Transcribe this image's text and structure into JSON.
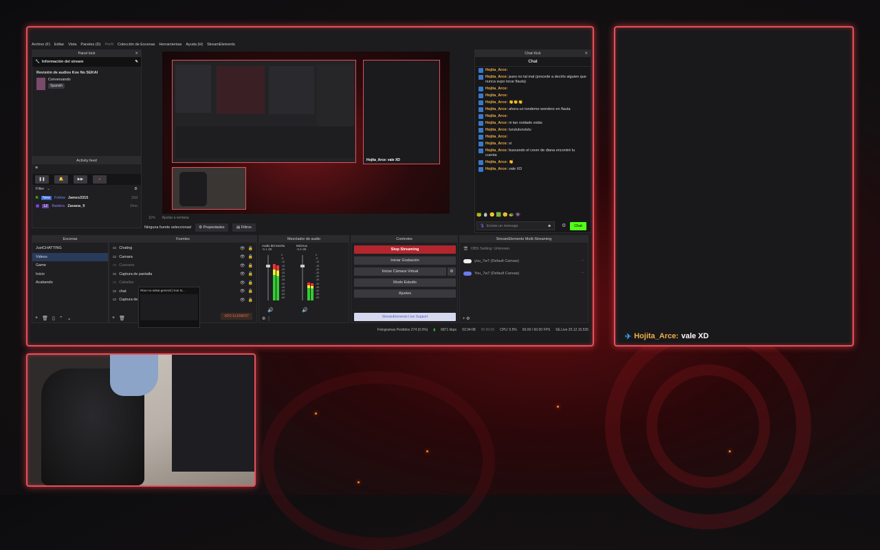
{
  "obs": {
    "menu": [
      "Archivo (F)",
      "Editar",
      "Vista",
      "Paneles (D)",
      "Perfil",
      "Colección de Escenas",
      "Herramientas",
      "Ayuda (H)",
      "StreamElements"
    ],
    "panel_kick": {
      "title": "Panel kick",
      "info_title": "Información del stream",
      "stream_title": "Revisión de audios Koe No SEKAI",
      "category": "Conversando",
      "tag": "Spanish"
    },
    "activity": {
      "title": "Activity feed",
      "filter": "Filter",
      "items": [
        {
          "badge": "New",
          "status": "Follow",
          "user": "James3315",
          "time": "15d"
        },
        {
          "badge": "12",
          "status": "Raiders",
          "user": "Zavana_9",
          "time": "2mo"
        }
      ]
    },
    "preview_overlay_chat": "Hojita_Arce: vale XD",
    "source_toolbar": {
      "none_selected": "Ninguna fuente seleccionad",
      "properties": "Propiedades",
      "filters": "Filtros",
      "zoom": "11%",
      "window": "Ajustar a ventana"
    },
    "chat_kick": {
      "title": "Chat Kick",
      "header": "Chat",
      "send_placeholder": "Enviar un mensaje",
      "send_button": "Chat",
      "messages": [
        {
          "user": "Hojita_Arce:",
          "text": ""
        },
        {
          "user": "Hojita_Arce:",
          "text": "pues no tal mal (procede a decirlo alguien que nunca supo tocar flauta)"
        },
        {
          "user": "Hojita_Arce:",
          "text": ""
        },
        {
          "user": "Hojita_Arce:",
          "text": ""
        },
        {
          "user": "Hojita_Arce:",
          "text": "👏👏👏"
        },
        {
          "user": "Hojita_Arce:",
          "text": "ahora un tondemo wonderz en flauta"
        },
        {
          "user": "Hojita_Arce:",
          "text": ""
        },
        {
          "user": "Hojita_Arce:",
          "text": "ni tan oxidado estás"
        },
        {
          "user": "Hojita_Arce:",
          "text": "turututurututu"
        },
        {
          "user": "Hojita_Arce:",
          "text": ""
        },
        {
          "user": "Hojita_Arce:",
          "text": "si"
        },
        {
          "user": "Hojita_Arce:",
          "text": "buscando el cover de diana encontré tu cuenta"
        },
        {
          "user": "Hojita_Arce:",
          "text": "👏"
        },
        {
          "user": "Hojita_Arce:",
          "text": "vale XD"
        }
      ]
    },
    "escenas": {
      "title": "Escenas",
      "items": [
        "JustCHATTING",
        "Videos",
        "Game",
        "Inicio",
        "Acabando"
      ],
      "selected": 1
    },
    "fuentes": {
      "title": "Fuentes",
      "items": [
        "Chating",
        "Camara",
        "Cuevana",
        "Captura de pantalla",
        "Caballas",
        "chat",
        "Captura de"
      ],
      "add": "ADD ELEMENT",
      "tooltip": "#koe-no-sekai-general | Koe N..."
    },
    "mezclador": {
      "title": "Mezclador de audio",
      "ch1": {
        "name": "Audio del escrito",
        "db": "-5.1 dB"
      },
      "ch2": {
        "name": "Mic/Aux",
        "db": "-5.6 dB"
      },
      "scale": [
        "0",
        "-5",
        "-10",
        "-15",
        "-20",
        "-25",
        "-30",
        "-35",
        "-40",
        "-45",
        "-50",
        "-55",
        "-60"
      ]
    },
    "controles": {
      "title": "Controles",
      "buttons": [
        "Stop Streaming",
        "Iniciar Grabación",
        "Iniciar Cámara Virtual",
        "Modo Estudio",
        "Ajustes"
      ],
      "support": "StreamElements Live Support"
    },
    "multistream": {
      "title": "StreamElements Multi-Streaming",
      "items": [
        {
          "name": "OBS Setting: Unknown"
        },
        {
          "name": "you_7w7 (Default Canvas)"
        },
        {
          "name": "You_7w7 (Default Canvas)"
        }
      ]
    },
    "status": {
      "dropped": "Fotogramas Perdidos 274 (0.0%)",
      "kbps": "6871 kbps",
      "live": "02:34:08",
      "rec": "00:00:00",
      "cpu": "CPU: 5.5%",
      "fps": "60.00 / 60.00 FPS",
      "se": "SE.Live 25.12.15.535"
    }
  },
  "overlay_chat": {
    "user": "Hojita_Arce:",
    "text": "vale XD"
  },
  "colors": {
    "accent": "#e8505a",
    "kick_green": "#53fc18",
    "user": "#f0b04a",
    "stop": "#b3262e"
  }
}
